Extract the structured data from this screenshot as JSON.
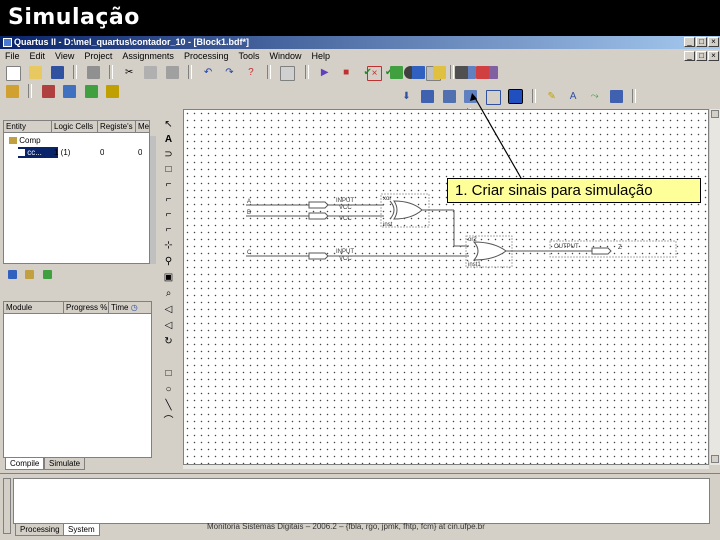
{
  "slide": {
    "title": "Simulação"
  },
  "window": {
    "title": "Quartus II - D:\\mel_quartus\\contador_10 - [Block1.bdf*]",
    "controls": {
      "minimize": "_",
      "maximize": "□",
      "close": "×"
    }
  },
  "menu": [
    "File",
    "Edit",
    "View",
    "Project",
    "Assignments",
    "Processing",
    "Tools",
    "Window",
    "Help"
  ],
  "hierarchy": {
    "columns": [
      "Entity",
      "Logic Cells",
      "Registe's",
      "Me"
    ],
    "rows": [
      {
        "entity": "Comp",
        "logic_cells": "",
        "registers": "",
        "mem": ""
      },
      {
        "entity": "cc...",
        "logic_cells": "1 (1)",
        "registers": "0",
        "mem": "0"
      }
    ]
  },
  "status": {
    "columns": [
      "Module",
      "Progress %",
      "Time"
    ]
  },
  "tabs": {
    "compile": "Compile",
    "simulate": "Simulate"
  },
  "messages": {
    "tabs": [
      "Processing",
      "System"
    ]
  },
  "schematic": {
    "inputs": [
      "A",
      "B",
      "C"
    ],
    "input_pin_label": "INPUT",
    "input_pin_sublabel": "VCC",
    "gates": [
      {
        "type": "xor",
        "label": "xor",
        "instance": "inst"
      },
      {
        "type": "or",
        "label": "or2",
        "instance": "inst1"
      }
    ],
    "output": {
      "pin_label": "OUTPUT",
      "name": "Z"
    }
  },
  "callout": {
    "text": "1. Criar sinais para simulação"
  },
  "footer": {
    "text": "Monitoria Sistemas Digitais – 2006.2 – {fbla, rgo, jpmk, fhtp, fcm} at cin.ufpe.br"
  }
}
